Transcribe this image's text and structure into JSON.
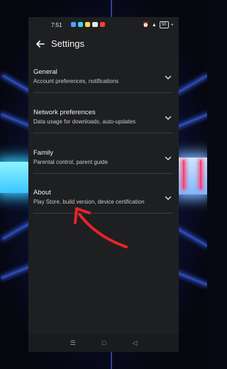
{
  "status_bar": {
    "time": "7:51",
    "battery": "50"
  },
  "header": {
    "title": "Settings"
  },
  "items": [
    {
      "label": "General",
      "subtitle": "Account preferences, notifications"
    },
    {
      "label": "Network preferences",
      "subtitle": "Data usage for downloads, auto-updates"
    },
    {
      "label": "Family",
      "subtitle": "Parental control, parent guide"
    },
    {
      "label": "About",
      "subtitle": "Play Store, build version, device certification"
    }
  ],
  "nav_bar": {
    "recents": "☰",
    "home": "□",
    "back": "◁"
  },
  "colors": {
    "screen_bg": "#1e1f21",
    "text_primary": "#f0f0f0",
    "text_secondary": "#c9c9c9",
    "annotation_arrow": "#e8232b"
  }
}
